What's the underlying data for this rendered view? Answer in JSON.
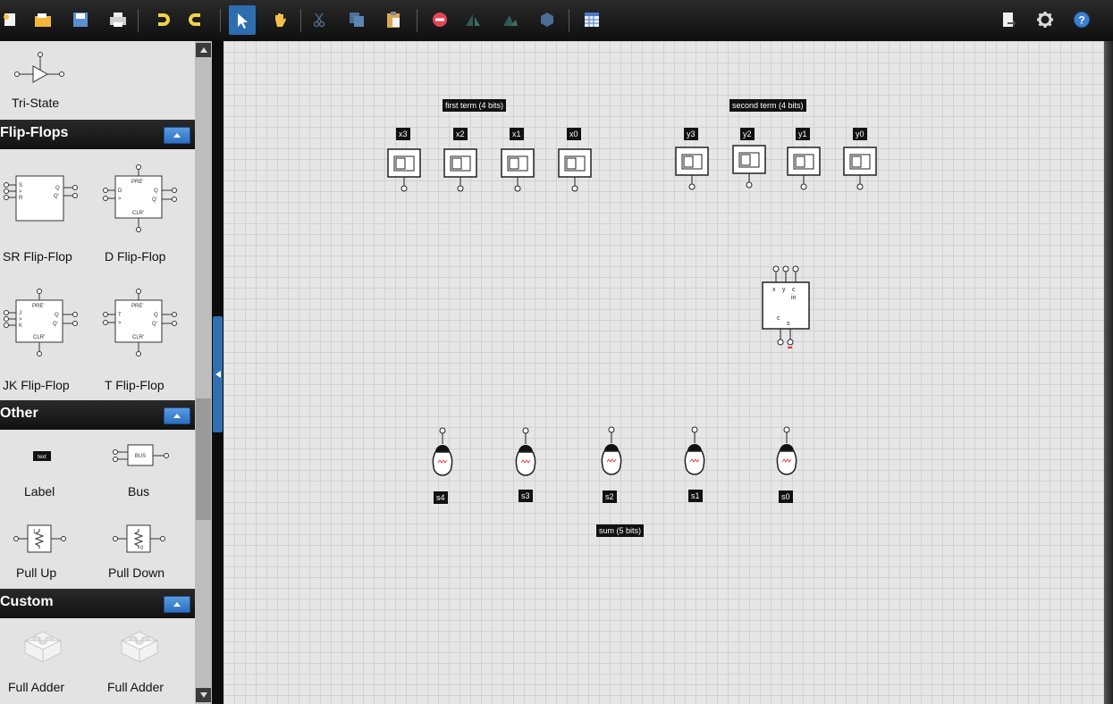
{
  "toolbar": {
    "buttons": [
      "new-icon",
      "open-icon",
      "save-icon",
      "print-icon",
      "undo-icon",
      "redo-icon",
      "select-tool-icon",
      "pan-tool-icon",
      "cut-icon",
      "copy-icon",
      "paste-icon",
      "delete-icon",
      "flip-icon",
      "rotate-icon",
      "hexagon-icon",
      "table-icon",
      "export-icon",
      "settings-icon",
      "help-icon"
    ]
  },
  "palette": {
    "tristate": "Tri-State",
    "cat_flipflops": "Flip-Flops",
    "sr": "SR Flip-Flop",
    "d": "D Flip-Flop",
    "jk": "JK Flip-Flop",
    "t": "T Flip-Flop",
    "cat_other": "Other",
    "label": "Label",
    "bus": "Bus",
    "pullup": "Pull Up",
    "pulldown": "Pull Down",
    "cat_custom": "Custom",
    "fulladder1": "Full Adder",
    "fulladder2": "Full Adder"
  },
  "glyphs": {
    "label_icon": "text",
    "bus_icon": "BUS",
    "pre": "PRE'",
    "clr": "CLR'",
    "q": "Q",
    "qn": "Q'",
    "s": "S",
    "r": "R",
    "d": "D",
    "j": "J",
    "k": "K",
    "t": "T",
    "gt": ">"
  },
  "circuit": {
    "first_term": "first term (4 bits)",
    "second_term": "second term (4 bits)",
    "x3": "x3",
    "x2": "x2",
    "x1": "x1",
    "x0": "x0",
    "y3": "y3",
    "y2": "y2",
    "y1": "y1",
    "y0": "y0",
    "s4": "s4",
    "s3": "s3",
    "s2": "s2",
    "s1": "s1",
    "s0": "s0",
    "sum": "sum (5 bits)"
  },
  "colors": {
    "accent": "#2e6eb0",
    "canvas_bg": "#e6e6e6",
    "category_bg": "#1a1a1a"
  }
}
